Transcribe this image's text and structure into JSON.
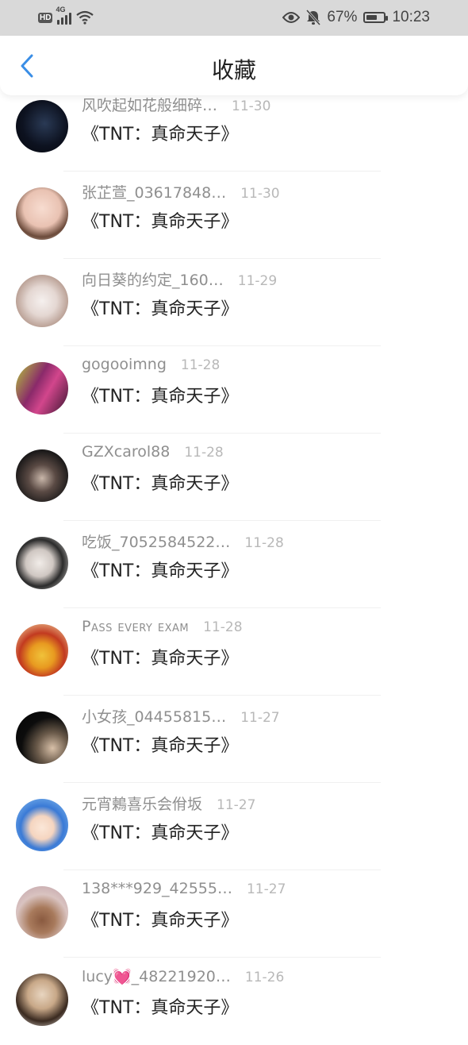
{
  "status_bar": {
    "hd": "HD",
    "network": "4G",
    "battery": "67%",
    "battery_level": 0.67,
    "time": "10:23"
  },
  "header": {
    "title": "收藏"
  },
  "items": [
    {
      "name": "风吹起如花般细碎…",
      "date": "11-30",
      "title": "《TNT：真命天子》"
    },
    {
      "name": "张芷萱_03617848…",
      "date": "11-30",
      "title": "《TNT：真命天子》"
    },
    {
      "name": "向日葵的约定_160…",
      "date": "11-29",
      "title": "《TNT：真命天子》"
    },
    {
      "name": "gogooimng",
      "date": "11-28",
      "title": "《TNT：真命天子》"
    },
    {
      "name": "GZXcarol88",
      "date": "11-28",
      "title": "《TNT：真命天子》"
    },
    {
      "name": "吃饭_7052584522…",
      "date": "11-28",
      "title": "《TNT：真命天子》"
    },
    {
      "name": "Pass every exam",
      "date": "11-28",
      "title": "《TNT：真命天子》"
    },
    {
      "name": "小女孩_04455815…",
      "date": "11-27",
      "title": "《TNT：真命天子》"
    },
    {
      "name": "元宵鶫喜乐会佾坂",
      "date": "11-27",
      "title": "《TNT：真命天子》"
    },
    {
      "name": "138***929_42555…",
      "date": "11-27",
      "title": "《TNT：真命天子》"
    },
    {
      "name": "lucy💓_48221920…",
      "date": "11-26",
      "title": "《TNT：真命天子》"
    }
  ]
}
